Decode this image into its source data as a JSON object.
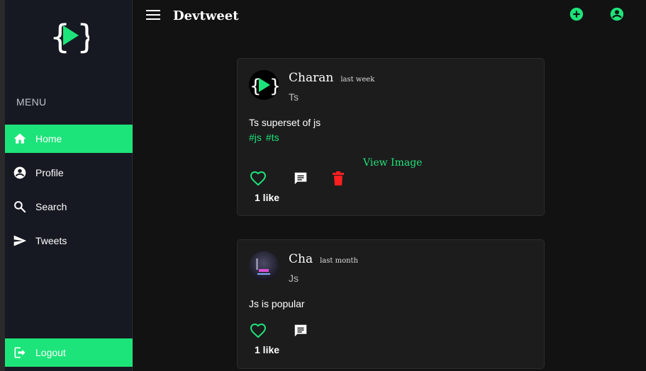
{
  "app": {
    "title": "Devtweet"
  },
  "sidebar": {
    "menu_label": "MENU",
    "items": [
      {
        "label": "Home",
        "icon": "home-icon",
        "active": true
      },
      {
        "label": "Profile",
        "icon": "account-circle-icon",
        "active": false
      },
      {
        "label": "Search",
        "icon": "search-icon",
        "active": false
      },
      {
        "label": "Tweets",
        "icon": "send-icon",
        "active": false
      }
    ],
    "logout": {
      "label": "Logout",
      "icon": "logout-icon"
    }
  },
  "topbar": {
    "add_icon": "add-circle-icon",
    "account_icon": "account-circle-icon"
  },
  "posts": [
    {
      "author": "Charan",
      "time": "last week",
      "subtitle": "Ts",
      "body": "Ts superset of js",
      "tags": [
        "#js",
        "#ts"
      ],
      "view_image": "View Image",
      "likes": "1 like"
    },
    {
      "author": "Cha",
      "time": "last month",
      "subtitle": "Js",
      "body": "Js is popular",
      "likes": "1 like"
    }
  ],
  "colors": {
    "accent": "#1de47a",
    "delete": "#ff1f1f",
    "background": "#121212",
    "sidebar": "#171922"
  }
}
